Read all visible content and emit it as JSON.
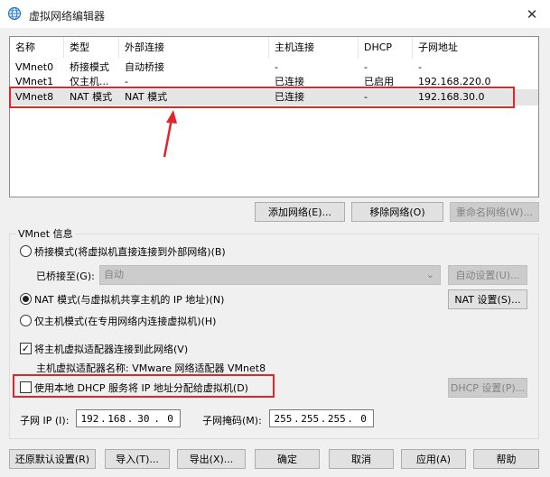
{
  "window": {
    "title": "虚拟网络编辑器",
    "close_glyph": "✕"
  },
  "table": {
    "columns": [
      "名称",
      "类型",
      "外部连接",
      "主机连接",
      "DHCP",
      "子网地址"
    ],
    "rows": [
      [
        "VMnet0",
        "桥接模式",
        "自动桥接",
        "-",
        "-",
        "-"
      ],
      [
        "VMnet1",
        "仅主机...",
        "-",
        "已连接",
        "已启用",
        "192.168.220.0"
      ],
      [
        "VMnet8",
        "NAT 模式",
        "NAT 模式",
        "已连接",
        "-",
        "192.168.30.0"
      ]
    ]
  },
  "buttons": {
    "add_network": "添加网络(E)...",
    "remove_network": "移除网络(O)",
    "rename_network": "重命名网络(W)...",
    "auto_settings": "自动设置(U)...",
    "nat_settings": "NAT 设置(S)...",
    "dhcp_settings": "DHCP 设置(P)...",
    "restore_defaults": "还原默认设置(R)",
    "import": "导入(T)...",
    "export": "导出(X)...",
    "ok": "确定",
    "cancel": "取消",
    "apply": "应用(A)",
    "help": "帮助"
  },
  "vmnet_info": {
    "group_label": "VMnet 信息",
    "bridged_label": "桥接模式(将虚拟机直接连接到外部网络)(B)",
    "bridged_to_label": "已桥接至(G):",
    "bridged_to_value": "自动",
    "nat_label": "NAT 模式(与虚拟机共享主机的 IP 地址)(N)",
    "host_only_label": "仅主机模式(在专用网络内连接虚拟机)(H)",
    "connect_adapter_label": "将主机虚拟适配器连接到此网络(V)",
    "adapter_name_text": "主机虚拟适配器名称: VMware 网络适配器 VMnet8",
    "dhcp_label": "使用本地 DHCP 服务将 IP 地址分配给虚拟机(D)",
    "subnet_ip_label": "子网 IP (I):",
    "subnet_ip": [
      "192",
      "168",
      "30",
      "0"
    ],
    "subnet_mask_label": "子网掩码(M):",
    "subnet_mask": [
      "255",
      "255",
      "255",
      "0"
    ],
    "selected_mode": "nat",
    "connect_adapter_checked": true,
    "dhcp_checked": false
  },
  "annotation": {
    "highlight_color": "#e0262d"
  }
}
